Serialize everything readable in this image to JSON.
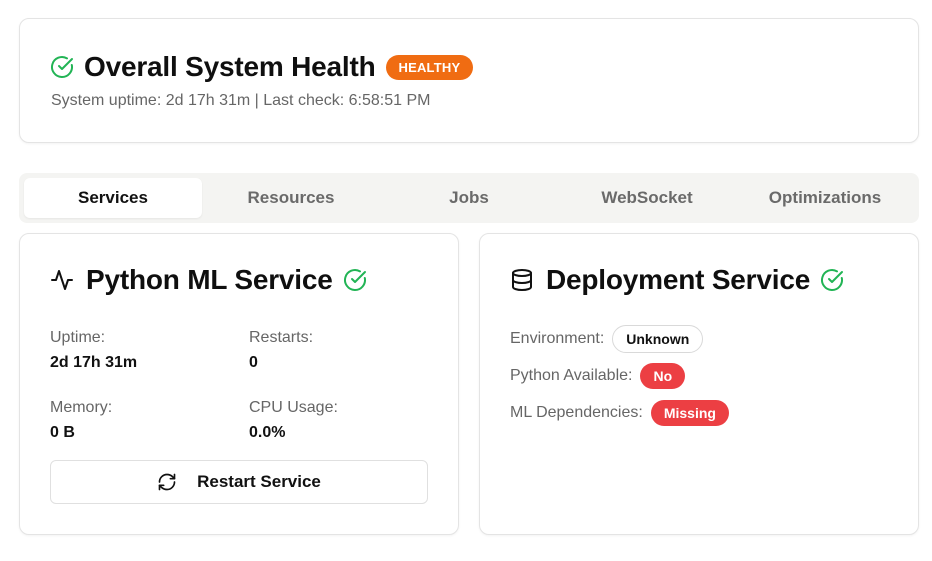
{
  "health": {
    "title": "Overall System Health",
    "status_badge": "HEALTHY",
    "subtitle": "System uptime: 2d 17h 31m | Last check: 6:58:51 PM",
    "icon": "check-circle-icon"
  },
  "tabs": [
    {
      "label": "Services",
      "active": true
    },
    {
      "label": "Resources",
      "active": false
    },
    {
      "label": "Jobs",
      "active": false
    },
    {
      "label": "WebSocket",
      "active": false
    },
    {
      "label": "Optimizations",
      "active": false
    }
  ],
  "python_service": {
    "title": "Python ML Service",
    "icon": "activity-icon",
    "status_icon": "check-circle-icon",
    "uptime_label": "Uptime:",
    "uptime_value": "2d 17h 31m",
    "restarts_label": "Restarts:",
    "restarts_value": "0",
    "memory_label": "Memory:",
    "memory_value": "0 B",
    "cpu_label": "CPU Usage:",
    "cpu_value": "0.0%",
    "restart_button": "Restart Service"
  },
  "deployment_service": {
    "title": "Deployment Service",
    "icon": "database-icon",
    "status_icon": "check-circle-icon",
    "environment_label": "Environment:",
    "environment_value": "Unknown",
    "python_label": "Python Available:",
    "python_value": "No",
    "ml_label": "ML Dependencies:",
    "ml_value": "Missing"
  },
  "colors": {
    "success": "#22b455",
    "warning": "#f06c12",
    "danger": "#ec3f43"
  }
}
